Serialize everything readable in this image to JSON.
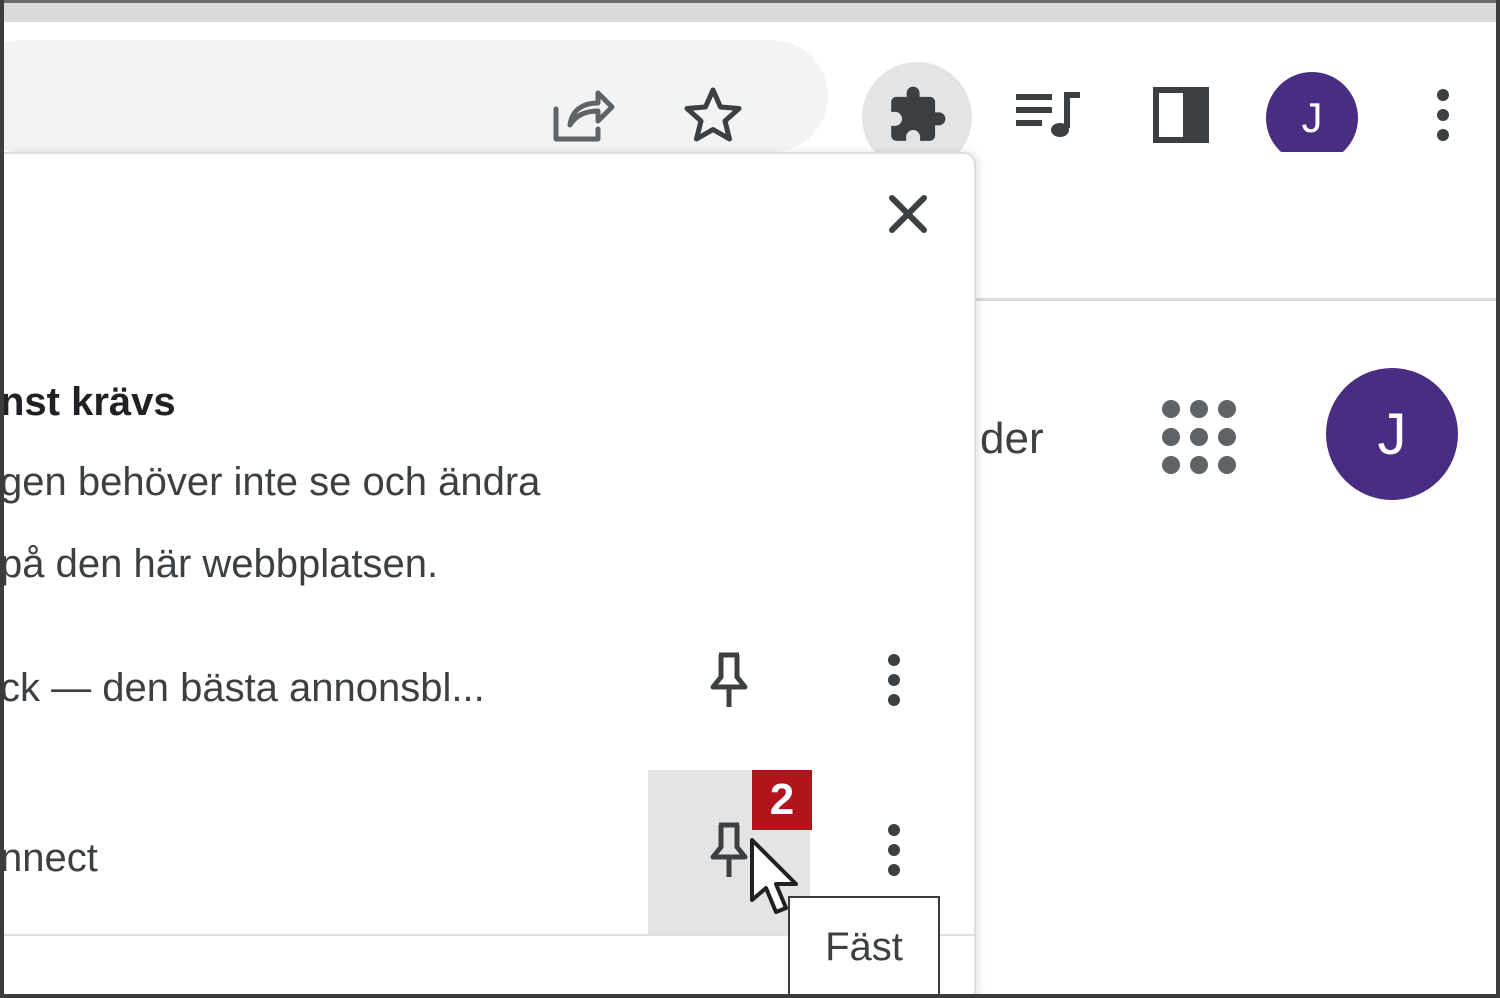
{
  "browser": {
    "toolbar": {
      "share_icon": "share-icon",
      "bookmark_icon": "star-icon",
      "extensions_icon": "puzzle-icon",
      "media_icon": "media-queue-icon",
      "side_panel_icon": "side-panel-icon",
      "profile_initial": "J",
      "menu_icon": "vertical-dots-icon"
    }
  },
  "page": {
    "partial_text": "der",
    "apps_icon": "apps-grid-icon",
    "avatar_initial": "J"
  },
  "extensions_panel": {
    "close_icon": "close-icon",
    "heading": "nst krävs",
    "description_line1": "gen behöver inte se och ändra",
    "description_line2": "på den här webbplatsen.",
    "items": [
      {
        "name": "ck — den bästa annonsbl...",
        "pin_icon": "pin-icon",
        "more_icon": "vertical-dots-icon"
      },
      {
        "name": "nnect",
        "pin_icon": "pin-icon",
        "more_icon": "vertical-dots-icon"
      }
    ]
  },
  "annotation": {
    "step_number": "2"
  },
  "tooltip": {
    "text": "Fäst"
  },
  "colors": {
    "profile": "#4b2c83",
    "badge": "#b3131b",
    "icon": "#3c4043",
    "hover": "#e4e4e4"
  }
}
